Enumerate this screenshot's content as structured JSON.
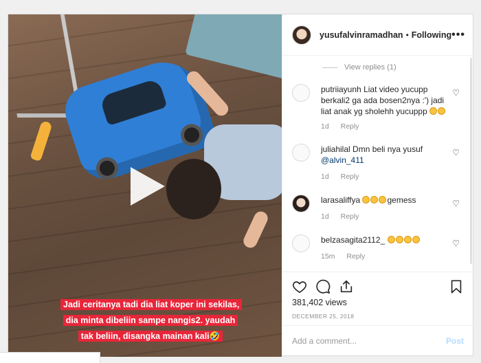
{
  "header": {
    "username": "yusufalvinramadhan",
    "separator": "•",
    "follow_label": "Following",
    "more_label": "•••"
  },
  "media": {
    "caption": "Jadi ceritanya tadi dia liat koper ini sekilas, dia minta dibeliin sampe nangis2. yaudah tak beliin, disangka mainan kali🤣"
  },
  "comments": {
    "view_replies": "View replies (1)",
    "items": [
      {
        "user": "putriiayunh",
        "text": "Liat video yucupp berkali2 ga ada bosen2nya :') jadi liat anak yg sholehh yucuppp",
        "emojis": 2,
        "mention": "",
        "time": "1d",
        "reply": "Reply"
      },
      {
        "user": "juliahilal",
        "text": "Dmn beli nya yusuf",
        "emojis": 0,
        "mention": "@alvin_411",
        "time": "1d",
        "reply": "Reply"
      },
      {
        "user": "larasaliffya",
        "text": "gemess",
        "emojis": 3,
        "mention": "",
        "time": "1d",
        "reply": "Reply"
      },
      {
        "user": "belzasagita2112_",
        "text": "",
        "emojis": 4,
        "mention": "",
        "time": "15m",
        "reply": "Reply"
      }
    ]
  },
  "stats": {
    "views": "381,402 views",
    "date": "DECEMBER 25, 2018"
  },
  "add_comment": {
    "placeholder": "Add a comment...",
    "post_label": "Post"
  },
  "colors": {
    "caption_bg": "#e8263a",
    "link": "#00376b",
    "post_disabled": "#b3dbff"
  }
}
